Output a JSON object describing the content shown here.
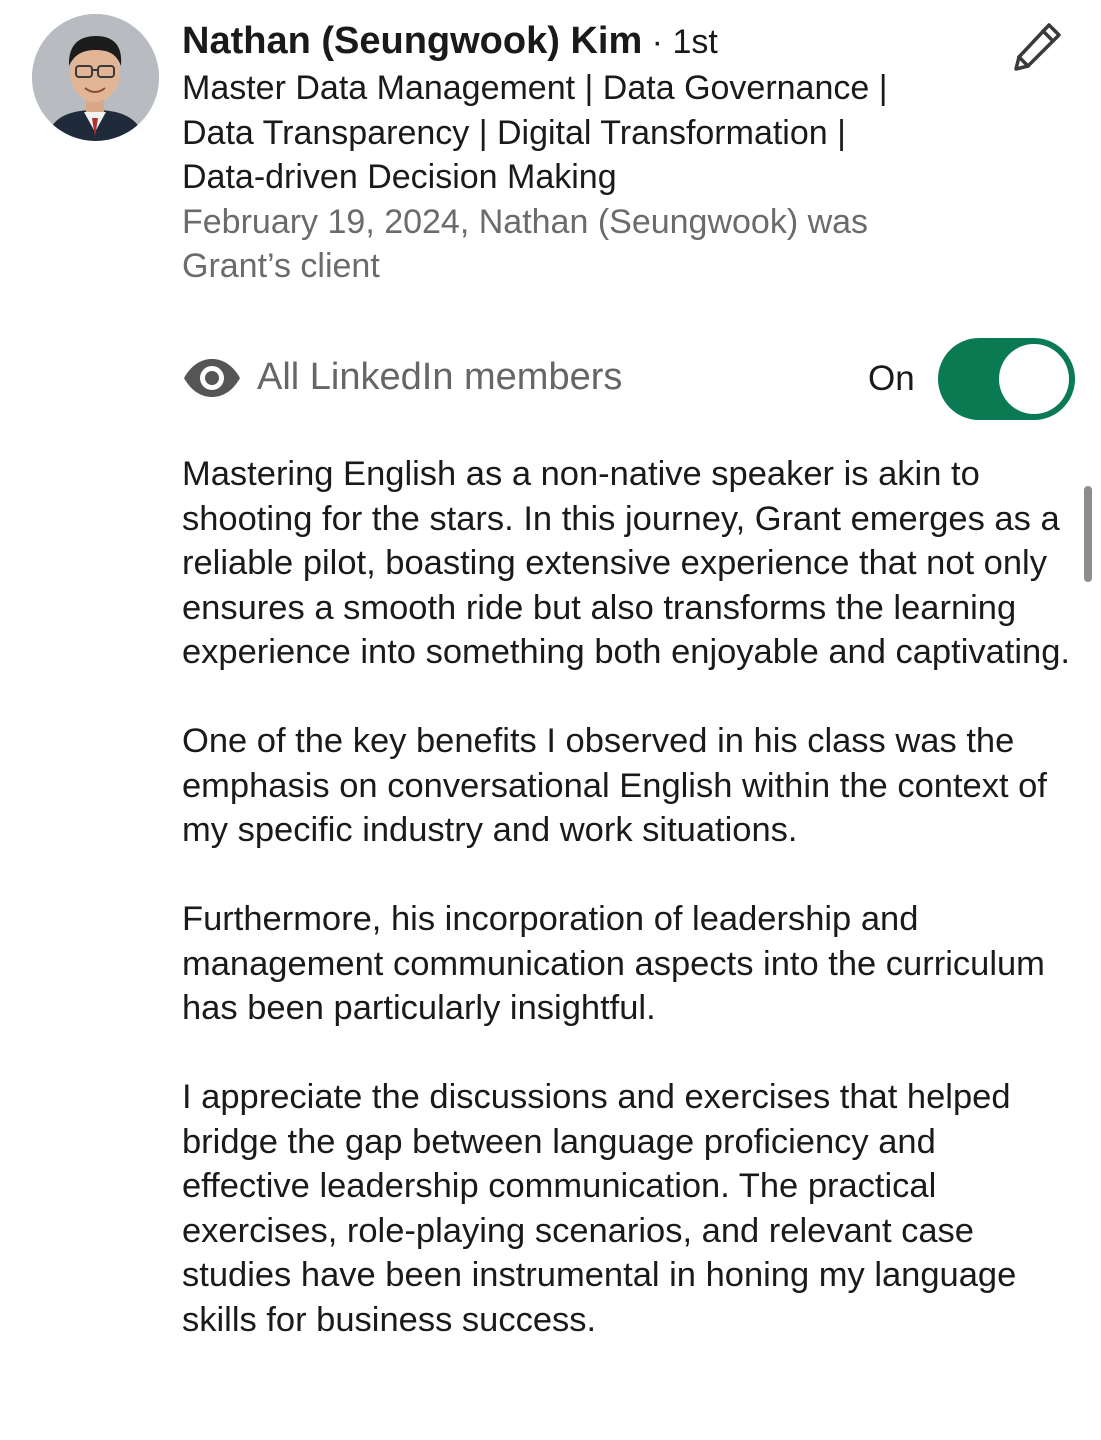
{
  "recommendation": {
    "author_name": "Nathan (Seungwook) Kim",
    "connection_degree": " · 1st",
    "author_headline": "Master Data Management | Data Governance | Data Transparency | Digital Transformation | Data-driven Decision Making",
    "meta_date_relation": "February 19, 2024, Nathan (Seungwook) was Grant’s client",
    "avatar_icon": "profile-photo",
    "edit_icon": "pencil-icon"
  },
  "visibility": {
    "icon": "eye-icon",
    "label": "All LinkedIn members",
    "toggle_state_label": "On",
    "toggle_on": true,
    "toggle_color": "#0a7a52"
  },
  "body": {
    "paragraphs": [
      "Mastering English as a non-native speaker is akin to shooting for the stars. In this journey, Grant emerges as a reliable pilot, boasting extensive experience that not only ensures a smooth ride but also transforms the learning experience into something both enjoyable and captivating.",
      "One of the key benefits I observed in his class was the emphasis on conversational English within the context of my specific industry and work situations.",
      "Furthermore, his incorporation of leadership and management communication aspects into the curriculum has been particularly insightful.",
      "I appreciate the discussions and exercises that helped bridge the gap between language proficiency and effective leadership communication. The practical exercises, role-playing scenarios, and relevant case studies have been instrumental in honing my language skills for business success."
    ]
  }
}
